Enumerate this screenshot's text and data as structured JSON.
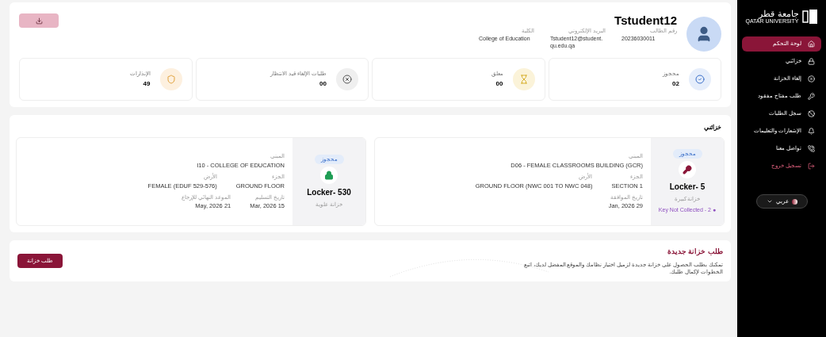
{
  "sidebar": {
    "logo_arabic": "جامعة قطر",
    "logo_english": "QATAR UNIVERSITY",
    "items": [
      {
        "label": "لوحة التحكم",
        "selected": true
      },
      {
        "label": "خزائني",
        "selected": false
      },
      {
        "label": "إلغاء الخزانة",
        "selected": false
      },
      {
        "label": "طلب مفتاح مفقود",
        "selected": false
      },
      {
        "label": "سجل الطلبات",
        "selected": false
      },
      {
        "label": "الإشعارات والتعليمات",
        "selected": false
      },
      {
        "label": "تواصل معنا",
        "selected": false
      },
      {
        "label": "تسجيل خروج",
        "selected": false
      }
    ],
    "language": "عربي"
  },
  "profile": {
    "name": "Tstudent12",
    "fields": [
      {
        "label": "رقم الطالب",
        "value": "20236030011"
      },
      {
        "label": "البريد الإلكتروني",
        "value": "Tstudent12@student.qu.edu.qa"
      },
      {
        "label": "الكلية",
        "value": "College of Education"
      }
    ]
  },
  "stats": [
    {
      "label": "محجوز",
      "value": "02"
    },
    {
      "label": "معلق",
      "value": "00"
    },
    {
      "label": "طلبات الإلغاء قيد الانتظار",
      "value": "00"
    },
    {
      "label": "الإنذارات",
      "value": "49"
    }
  ],
  "my_lockers": {
    "title": "خزائني",
    "lockers": [
      {
        "status": "محجوز",
        "name": "Locker- 5",
        "type": "خزانة كبيرة",
        "note": "Key Not Collected - 2 ●",
        "building_label": "المبنى",
        "building": "D06 - FEMALE CLASSROOMS BUILDING (GCR)",
        "details": [
          {
            "label": "الجزء",
            "value": "SECTION 1"
          },
          {
            "label": "الأرض",
            "value": "GROUND FLOOR (NWC 001 TO NWC 048)"
          }
        ],
        "dates": [
          {
            "label": "تاريخ الموافقة",
            "value": "Jan, 2026 29"
          }
        ]
      },
      {
        "status": "محجوز",
        "name": "Locker- 530",
        "type": "خزانة علوية",
        "building_label": "المبنى",
        "building": "I10 - COLLEGE OF EDUCATION",
        "details": [
          {
            "label": "الجزء",
            "value": "GROUND FLOOR"
          },
          {
            "label": "الأرض",
            "value": "FEMALE (EDUF 529-576)"
          }
        ],
        "dates": [
          {
            "label": "تاريخ التسليم",
            "value": "Mar, 2026 15"
          },
          {
            "label": "الموعد النهائي للإرجاع",
            "value": "May, 2026 21"
          }
        ]
      }
    ]
  },
  "new_request": {
    "title": "طلب خزانة جديدة",
    "description": "تمكنك بطلب الحصول على خزانة جديدة لزميل اختيار نظامك والموقع المفضل لديك، اتبع الخطوات لإكمال طلبك.",
    "button": "طلب خزانة"
  }
}
